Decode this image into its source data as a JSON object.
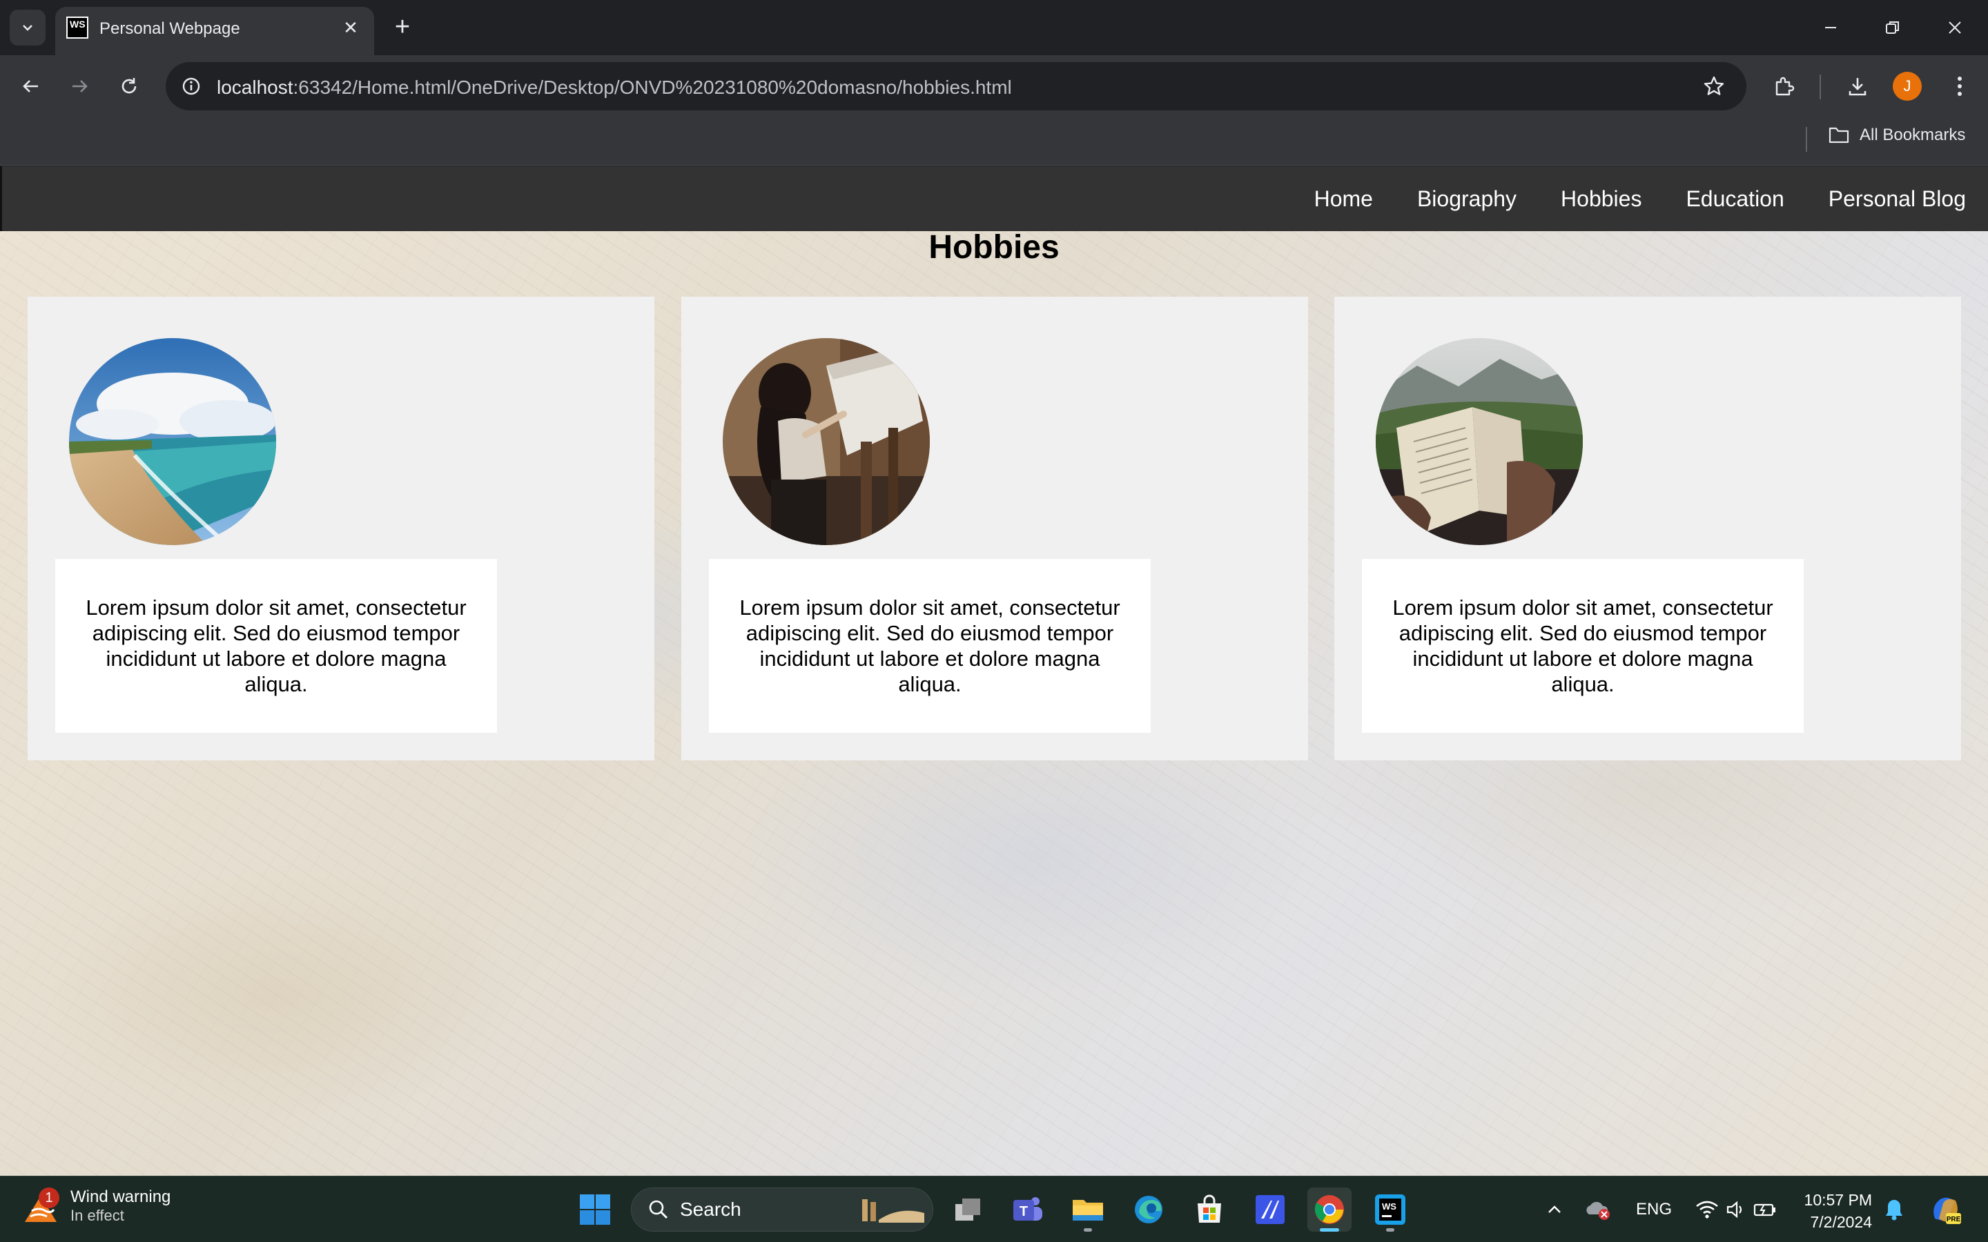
{
  "browser": {
    "tab_title": "Personal Webpage",
    "favicon_text": "WS",
    "url_host": "localhost",
    "url_rest": ":63342/Home.html/OneDrive/Desktop/ONVD%20231080%20domasno/hobbies.html",
    "bookmarks_label": "All Bookmarks",
    "profile_initial": "J"
  },
  "site": {
    "nav": {
      "items": [
        {
          "label": "Home"
        },
        {
          "label": "Biography"
        },
        {
          "label": "Hobbies"
        },
        {
          "label": "Education"
        },
        {
          "label": "Personal Blog"
        }
      ]
    },
    "title": "Hobbies",
    "cards": [
      {
        "image": "beach-photo",
        "text": "Lorem ipsum dolor sit amet, consectetur adipiscing elit. Sed do eiusmod tempor incididunt ut labore et dolore magna aliqua."
      },
      {
        "image": "painting-photo",
        "text": "Lorem ipsum dolor sit amet, consectetur adipiscing elit. Sed do eiusmod tempor incididunt ut labore et dolore magna aliqua."
      },
      {
        "image": "reading-photo",
        "text": "Lorem ipsum dolor sit amet, consectetur adipiscing elit. Sed do eiusmod tempor incididunt ut labore et dolore magna aliqua."
      }
    ]
  },
  "taskbar": {
    "weather_title": "Wind warning",
    "weather_sub": "In effect",
    "weather_badge": "1",
    "search_label": "Search",
    "language": "ENG",
    "time": "10:57 PM",
    "date": "7/2/2024"
  },
  "colors": {
    "chrome_dark": "#202124",
    "chrome_toolbar": "#35363a",
    "site_nav": "#333333",
    "card_bg": "#f0f0f0",
    "taskbar": "#1c2a26"
  }
}
